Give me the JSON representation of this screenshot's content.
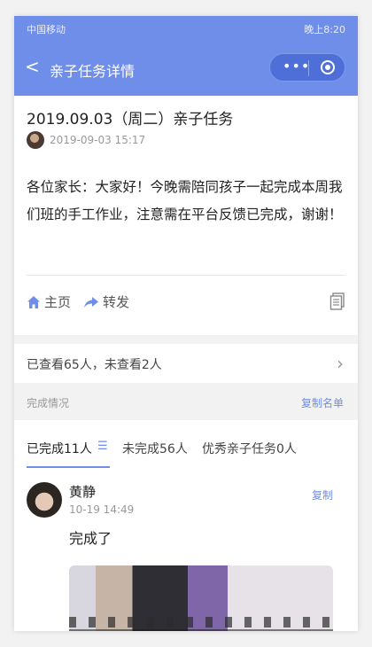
{
  "status_bar": {
    "carrier": "中国移动",
    "time": "晚上8:20"
  },
  "titlebar": {
    "back": "<",
    "title": "亲子任务详情",
    "more": "•••"
  },
  "article": {
    "title": "2019.09.03（周二）亲子任务",
    "timestamp": "2019-09-03 15:17",
    "body": "各位家长：大家好！今晚需陪同孩子一起完成本周我们班的手工作业，注意需在平台反馈已完成，谢谢！"
  },
  "actions": {
    "home": "主页",
    "share": "转发"
  },
  "viewed": {
    "text": "已查看65人，未查看2人"
  },
  "completion": {
    "label": "完成情况",
    "copy_list": "复制名单"
  },
  "tabs": [
    {
      "label": "已完成11人"
    },
    {
      "label": "未完成56人"
    },
    {
      "label": "优秀亲子任务0人"
    }
  ],
  "post": {
    "name": "黄静",
    "time": "10-19 14:49",
    "copy": "复制",
    "content": "完成了"
  },
  "colors": {
    "primary": "#6f8ee9",
    "capsule": "#4f6fd8",
    "gray_bg": "#f2f2f2"
  }
}
